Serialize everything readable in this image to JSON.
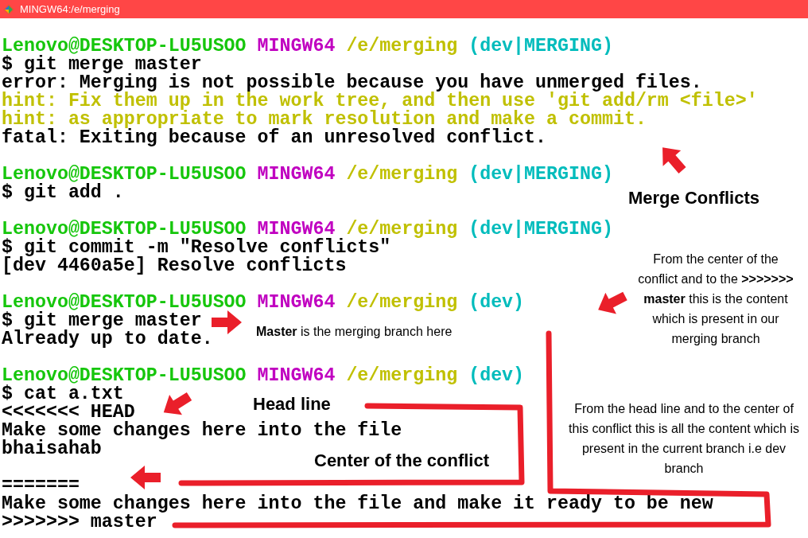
{
  "window": {
    "title": "MINGW64:/e/merging"
  },
  "terminal": {
    "blocks": [
      [
        {
          "kind": "prompt",
          "user": "Lenovo@DESKTOP-LU5USOO",
          "system": "MINGW64",
          "path": "/e/merging",
          "branch": "(dev|MERGING)"
        },
        {
          "kind": "command",
          "text": "$ git merge master"
        },
        {
          "kind": "error",
          "text": "error: Merging is not possible because you have unmerged files."
        },
        {
          "kind": "hint",
          "text": "hint: Fix them up in the work tree, and then use 'git add/rm <file>'"
        },
        {
          "kind": "hint",
          "text": "hint: as appropriate to mark resolution and make a commit."
        },
        {
          "kind": "error",
          "text": "fatal: Exiting because of an unresolved conflict."
        }
      ],
      [
        {
          "kind": "prompt",
          "user": "Lenovo@DESKTOP-LU5USOO",
          "system": "MINGW64",
          "path": "/e/merging",
          "branch": "(dev|MERGING)"
        },
        {
          "kind": "command",
          "text": "$ git add ."
        }
      ],
      [
        {
          "kind": "prompt",
          "user": "Lenovo@DESKTOP-LU5USOO",
          "system": "MINGW64",
          "path": "/e/merging",
          "branch": "(dev|MERGING)"
        },
        {
          "kind": "command",
          "text": "$ git commit -m \"Resolve conflicts\""
        },
        {
          "kind": "output",
          "text": "[dev 4460a5e] Resolve conflicts"
        }
      ],
      [
        {
          "kind": "prompt",
          "user": "Lenovo@DESKTOP-LU5USOO",
          "system": "MINGW64",
          "path": "/e/merging",
          "branch": "(dev)"
        },
        {
          "kind": "command",
          "text": "$ git merge master"
        },
        {
          "kind": "output",
          "text": "Already up to date."
        }
      ],
      [
        {
          "kind": "prompt",
          "user": "Lenovo@DESKTOP-LU5USOO",
          "system": "MINGW64",
          "path": "/e/merging",
          "branch": "(dev)"
        },
        {
          "kind": "command",
          "text": "$ cat a.txt"
        },
        {
          "kind": "output",
          "text": "<<<<<<< HEAD"
        },
        {
          "kind": "output",
          "text": "Make some changes here into the file"
        },
        {
          "kind": "output",
          "text": "bhaisahab"
        }
      ],
      [
        {
          "kind": "output",
          "text": "======="
        },
        {
          "kind": "output",
          "text": "Make some changes here into the file and make it ready to be new"
        },
        {
          "kind": "output",
          "text": ">>>>>>> master"
        }
      ]
    ]
  },
  "annotations": [
    {
      "kind": "heading",
      "text": "Merge Conflicts"
    },
    {
      "kind": "note",
      "text": "From the center of the conflict and to the **>>>>>>> master** this is the content which is present in our merging branch"
    },
    {
      "kind": "note",
      "text": "**Master** is the merging branch here"
    },
    {
      "kind": "heading",
      "text": "Head line"
    },
    {
      "kind": "heading",
      "text": "Center of the conflict"
    },
    {
      "kind": "note",
      "text": "From the head line and to the center of this conflict this is all the content which is present in the current branch i.e dev branch"
    }
  ]
}
